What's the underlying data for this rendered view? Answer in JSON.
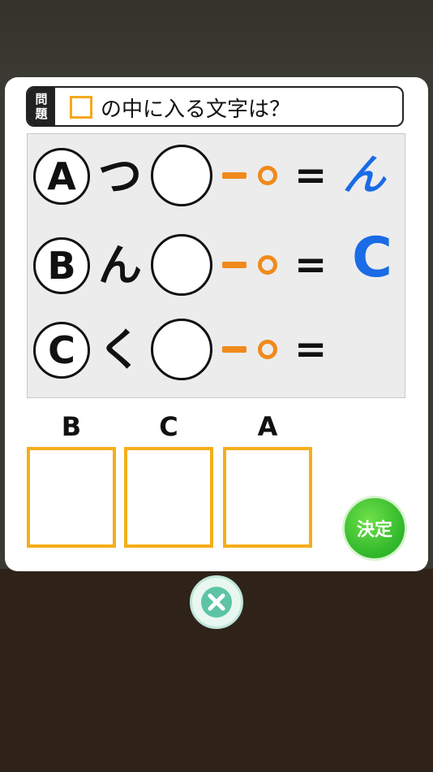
{
  "question": {
    "tag_line1": "問",
    "tag_line2": "題",
    "text": "の中に入る文字は？"
  },
  "rows": [
    {
      "letter": "A",
      "kana": "つ",
      "equals": "=",
      "answer": "ん"
    },
    {
      "letter": "B",
      "kana": "ん",
      "equals": "=",
      "answer": "C"
    },
    {
      "letter": "C",
      "kana": "く",
      "equals": "=",
      "answer": ""
    }
  ],
  "slots": [
    {
      "label": "B"
    },
    {
      "label": "C"
    },
    {
      "label": "A"
    }
  ],
  "confirm_label": "決定",
  "colors": {
    "accent_orange": "#f08a1c",
    "slot_border": "#f5ae1a",
    "answer_blue": "#1a6be6",
    "confirm_green": "#2fb62a"
  },
  "icons": {
    "close": "close-x-icon"
  }
}
